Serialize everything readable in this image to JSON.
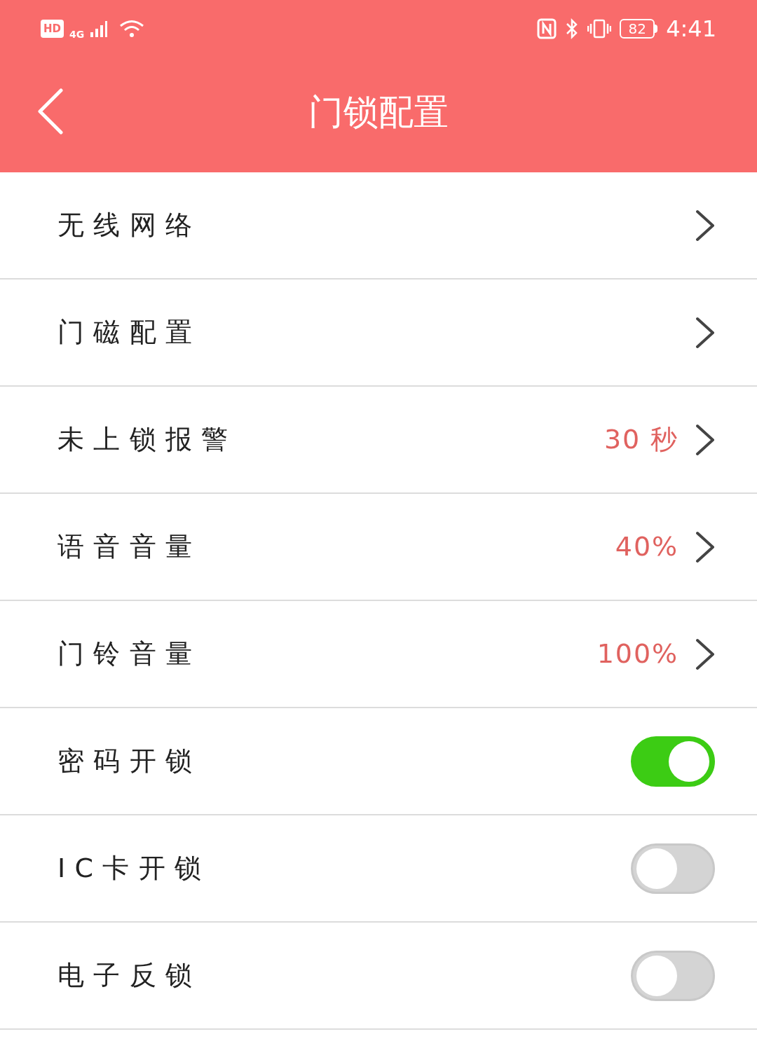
{
  "status_bar": {
    "hd": "HD",
    "network": "4G",
    "battery": "82",
    "time": "4:41"
  },
  "header": {
    "title": "门锁配置"
  },
  "rows": [
    {
      "kind": "link",
      "label": "无线网络"
    },
    {
      "kind": "link",
      "label": "门磁配置"
    },
    {
      "kind": "link",
      "label": "未上锁报警",
      "value": "30 秒"
    },
    {
      "kind": "link",
      "label": "语音音量",
      "value": "40%"
    },
    {
      "kind": "link",
      "label": "门铃音量",
      "value": "100%"
    },
    {
      "kind": "toggle",
      "label": "密码开锁",
      "on": true
    },
    {
      "kind": "toggle",
      "label": "IC卡开锁",
      "on": false
    },
    {
      "kind": "toggle",
      "label": "电子反锁",
      "on": false
    }
  ]
}
